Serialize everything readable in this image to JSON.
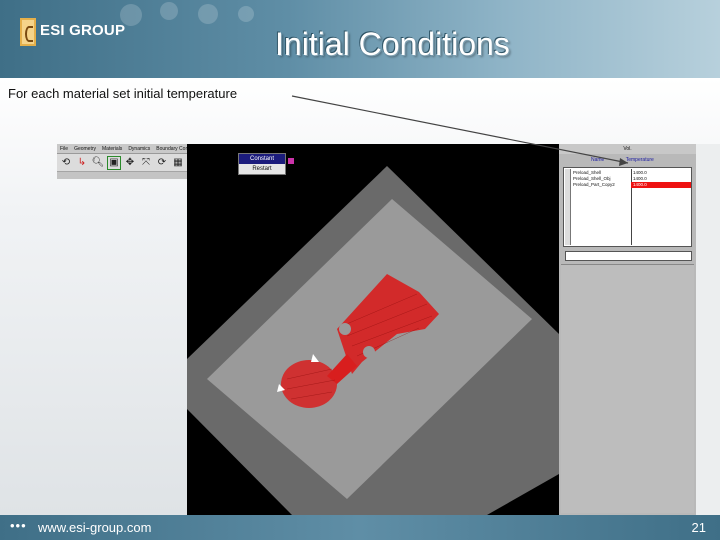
{
  "slide": {
    "title": "Initial Conditions",
    "caption": "For each material set initial temperature",
    "logo_text": "ESI GROUP",
    "footer_dots": "•••",
    "footer_url": "www.esi-group.com",
    "page_number": "21"
  },
  "app": {
    "menu": [
      "File",
      "Geometry",
      "Materials",
      "Dynamics",
      "Boundary Conditions",
      "Process",
      "Initial Conditions",
      "Run Parameters",
      "Windows",
      "Help"
    ],
    "active_menu_index": 6,
    "dropdown": {
      "items": [
        "Constant",
        "Restart"
      ],
      "highlighted_index": 0
    },
    "toolbar_icons": [
      "select-icon",
      "axis-icon",
      "zoom-icon",
      "zoom-box-icon",
      "fit-icon",
      "translate-icon",
      "rotate-icon",
      "mesh-icon",
      "view-icon",
      "copy-icon"
    ],
    "panel": {
      "title": "Vol.",
      "header_left": "Name",
      "header_right": "Temperature",
      "rows": [
        {
          "name": "Preload_Shell",
          "temp": "1400.0",
          "highlighted": false
        },
        {
          "name": "Preload_Shell_Obj",
          "temp": "1400.0",
          "highlighted": false
        },
        {
          "name": "Preload_Part_Copy2",
          "temp": "1400.0",
          "highlighted": true
        }
      ]
    }
  },
  "colors": {
    "header": "#4a7a92",
    "viewport_bg": "#000000",
    "mold_light": "#9a9a9a",
    "mold_dark": "#6a6a6a",
    "mesh": "#d81e1e",
    "highlight_red": "#ee1111"
  }
}
